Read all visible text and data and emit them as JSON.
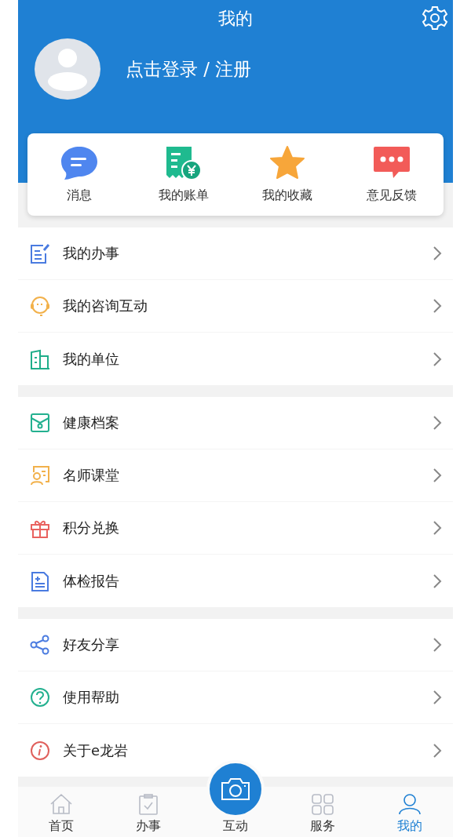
{
  "header": {
    "title": "我的",
    "login": "点击登录 / 注册"
  },
  "shortcuts": [
    {
      "label": "消息",
      "kind": "message"
    },
    {
      "label": "我的账单",
      "kind": "bill"
    },
    {
      "label": "我的收藏",
      "kind": "star"
    },
    {
      "label": "意见反馈",
      "kind": "feedback"
    }
  ],
  "groups": [
    [
      {
        "label": "我的办事",
        "kind": "tasks"
      },
      {
        "label": "我的咨询互动",
        "kind": "consult"
      },
      {
        "label": "我的单位",
        "kind": "building"
      }
    ],
    [
      {
        "label": "健康档案",
        "kind": "file"
      },
      {
        "label": "名师课堂",
        "kind": "class"
      },
      {
        "label": "积分兑换",
        "kind": "gift"
      },
      {
        "label": "体检报告",
        "kind": "report"
      }
    ],
    [
      {
        "label": "好友分享",
        "kind": "share"
      },
      {
        "label": "使用帮助",
        "kind": "help"
      },
      {
        "label": "关于e龙岩",
        "kind": "info"
      }
    ]
  ],
  "tabs": [
    {
      "label": "首页",
      "kind": "home",
      "selected": false
    },
    {
      "label": "办事",
      "kind": "clipboard",
      "selected": false
    },
    {
      "label": "互动",
      "kind": "camera",
      "selected": false
    },
    {
      "label": "服务",
      "kind": "grid",
      "selected": false
    },
    {
      "label": "我的",
      "kind": "user",
      "selected": true
    }
  ]
}
